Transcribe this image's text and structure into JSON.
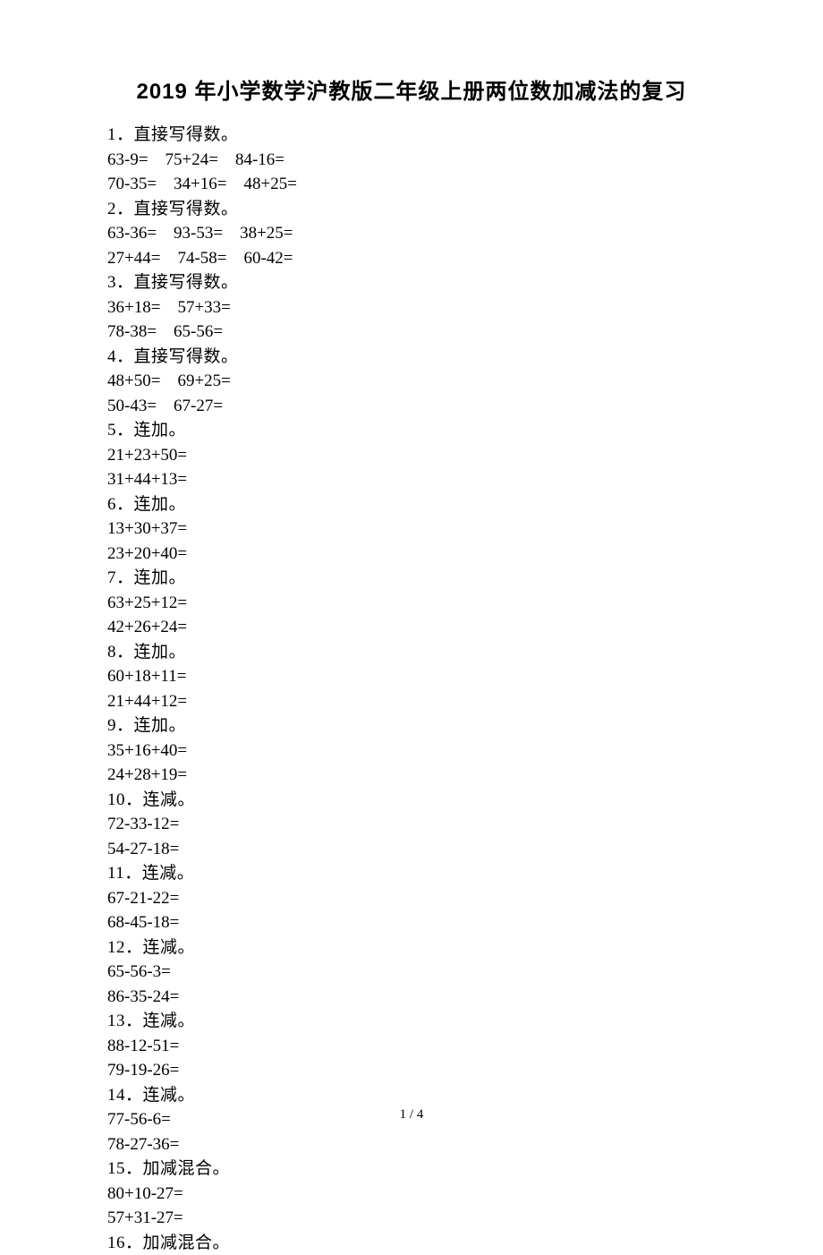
{
  "title": "2019 年小学数学沪教版二年级上册两位数加减法的复习",
  "footer": "1 / 4",
  "sections": {
    "s1": {
      "prompt": "1．直接写得数。",
      "rows": [
        [
          "63-9=",
          "75+24=",
          "84-16="
        ],
        [
          "70-35=",
          "34+16=",
          "48+25="
        ]
      ]
    },
    "s2": {
      "prompt": "2．直接写得数。",
      "rows": [
        [
          "63-36=",
          "93-53=",
          "38+25="
        ],
        [
          "27+44=",
          "74-58=",
          "60-42="
        ]
      ]
    },
    "s3": {
      "prompt": "3．直接写得数。",
      "rows": [
        [
          "36+18=",
          "57+33="
        ],
        [
          "78-38=",
          "65-56="
        ]
      ]
    },
    "s4": {
      "prompt": "4．直接写得数。",
      "rows": [
        [
          "48+50=",
          "69+25="
        ],
        [
          "50-43=",
          "67-27="
        ]
      ]
    },
    "s5": {
      "prompt": "5．连加。",
      "rows": [
        [
          "21+23+50="
        ],
        [
          "31+44+13="
        ]
      ]
    },
    "s6": {
      "prompt": "6．连加。",
      "rows": [
        [
          "13+30+37="
        ],
        [
          "23+20+40="
        ]
      ]
    },
    "s7": {
      "prompt": "7．连加。",
      "rows": [
        [
          "63+25+12="
        ],
        [
          "42+26+24="
        ]
      ]
    },
    "s8": {
      "prompt": "8．连加。",
      "rows": [
        [
          "60+18+11="
        ],
        [
          "21+44+12="
        ]
      ]
    },
    "s9": {
      "prompt": "9．连加。",
      "rows": [
        [
          "35+16+40="
        ],
        [
          "24+28+19="
        ]
      ]
    },
    "s10": {
      "prompt": "10．连减。",
      "rows": [
        [
          "72-33-12="
        ],
        [
          "54-27-18="
        ]
      ]
    },
    "s11": {
      "prompt": "11．连减。",
      "rows": [
        [
          "67-21-22="
        ],
        [
          "68-45-18="
        ]
      ]
    },
    "s12": {
      "prompt": "12．连减。",
      "rows": [
        [
          "65-56-3="
        ],
        [
          "86-35-24="
        ]
      ]
    },
    "s13": {
      "prompt": "13．连减。",
      "rows": [
        [
          "88-12-51="
        ],
        [
          "79-19-26="
        ]
      ]
    },
    "s14": {
      "prompt": "14．连减。",
      "rows": [
        [
          "77-56-6="
        ],
        [
          "78-27-36="
        ]
      ]
    },
    "s15": {
      "prompt": "15．加减混合。",
      "rows": [
        [
          "80+10-27="
        ],
        [
          "57+31-27="
        ]
      ]
    },
    "s16": {
      "prompt": "16．加减混合。",
      "rows": []
    }
  },
  "gap3": "    ",
  "gap2": "    "
}
